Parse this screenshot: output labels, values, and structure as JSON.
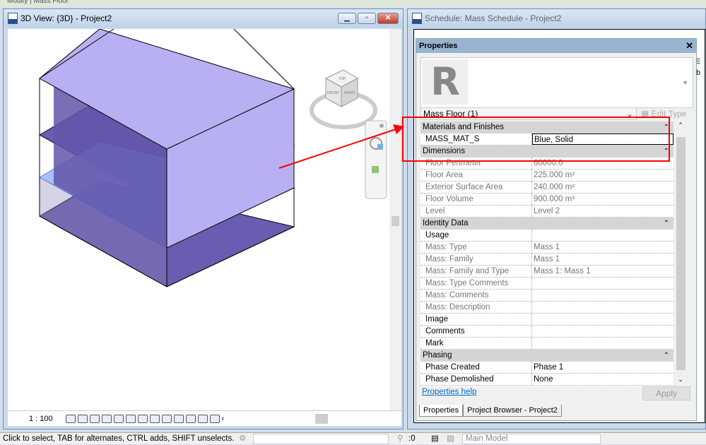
{
  "app": {
    "ribbon_context": "Modify | Mass Floor"
  },
  "view3d": {
    "title": "3D View: {3D} - Project2",
    "scale": "1 : 100",
    "viewcube": {
      "top": "TOP",
      "front": "FRONT",
      "right": "RIGHT"
    }
  },
  "schedule": {
    "title": "Schedule: Mass Schedule - Project2",
    "cells": [
      "E",
      "b"
    ]
  },
  "properties": {
    "title": "Properties",
    "type_selector": "Mass Floor (1)",
    "edit_type": "Edit Type",
    "groups": [
      {
        "name": "Materials and Finishes",
        "rows": [
          {
            "k": "MASS_MAT_S",
            "v": "Blue, Solid",
            "ro": false,
            "edit": true
          }
        ]
      },
      {
        "name": "Dimensions",
        "rows": [
          {
            "k": "Floor Perimeter",
            "v": "60000.0",
            "ro": true
          },
          {
            "k": "Floor Area",
            "v": "225.000 m²",
            "ro": true
          },
          {
            "k": "Exterior Surface Area",
            "v": "240.000 m²",
            "ro": true
          },
          {
            "k": "Floor Volume",
            "v": "900.000 m³",
            "ro": true
          },
          {
            "k": "Level",
            "v": "Level 2",
            "ro": true
          }
        ]
      },
      {
        "name": "Identity Data",
        "rows": [
          {
            "k": "Usage",
            "v": "",
            "ro": false
          },
          {
            "k": "Mass: Type",
            "v": "Mass 1",
            "ro": true
          },
          {
            "k": "Mass: Family",
            "v": "Mass 1",
            "ro": true
          },
          {
            "k": "Mass: Family and Type",
            "v": "Mass 1: Mass 1",
            "ro": true
          },
          {
            "k": "Mass: Type Comments",
            "v": "",
            "ro": true
          },
          {
            "k": "Mass: Comments",
            "v": "",
            "ro": true
          },
          {
            "k": "Mass: Description",
            "v": "",
            "ro": true
          },
          {
            "k": "Image",
            "v": "",
            "ro": false
          },
          {
            "k": "Comments",
            "v": "",
            "ro": false
          },
          {
            "k": "Mark",
            "v": "",
            "ro": false
          }
        ]
      },
      {
        "name": "Phasing",
        "rows": [
          {
            "k": "Phase Created",
            "v": "Phase 1",
            "ro": false
          },
          {
            "k": "Phase Demolished",
            "v": "None",
            "ro": false
          }
        ]
      }
    ],
    "help_link": "Properties help",
    "apply": "Apply",
    "tabs": [
      "Properties",
      "Project Browser - Project2"
    ]
  },
  "status": {
    "hint": "Click to select, TAB for alternates, CTRL adds, SHIFT unselects.",
    "filter_count": ":0",
    "model": "Main Model"
  },
  "colors": {
    "annotation": "#ff0000",
    "mass_light": "#b8b0f2",
    "mass_dark": "#6a5cb0",
    "selected_floor": "#8fb2f5"
  }
}
